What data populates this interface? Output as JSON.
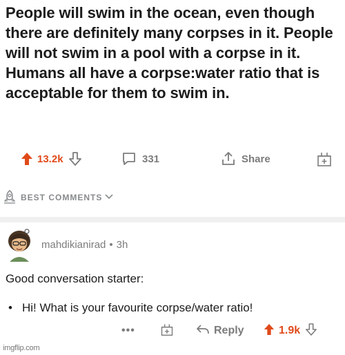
{
  "post": {
    "title": "People will swim in the ocean, even though there are definitely many corpses in it. People will not swim in a pool with a corpse in it. Humans all have a corpse:water ratio that is acceptable for them to swim in.",
    "upvotes": "13.2k",
    "comments": "331",
    "share_label": "Share"
  },
  "best_comments": {
    "label": "BEST COMMENTS"
  },
  "comment": {
    "username": "mahdikianirad",
    "separator": "•",
    "age": "3h",
    "body": "Good conversation starter:",
    "bullet_mark": "•",
    "bullet_text": "Hi! What is your favourite corpse/water ratio!",
    "more": "•••",
    "reply_label": "Reply",
    "upvotes": "1.9k"
  },
  "watermark": "imgflip.com",
  "colors": {
    "upvote": "#e04a1a",
    "muted": "#7c7c7c",
    "text": "#1c1c1c"
  }
}
